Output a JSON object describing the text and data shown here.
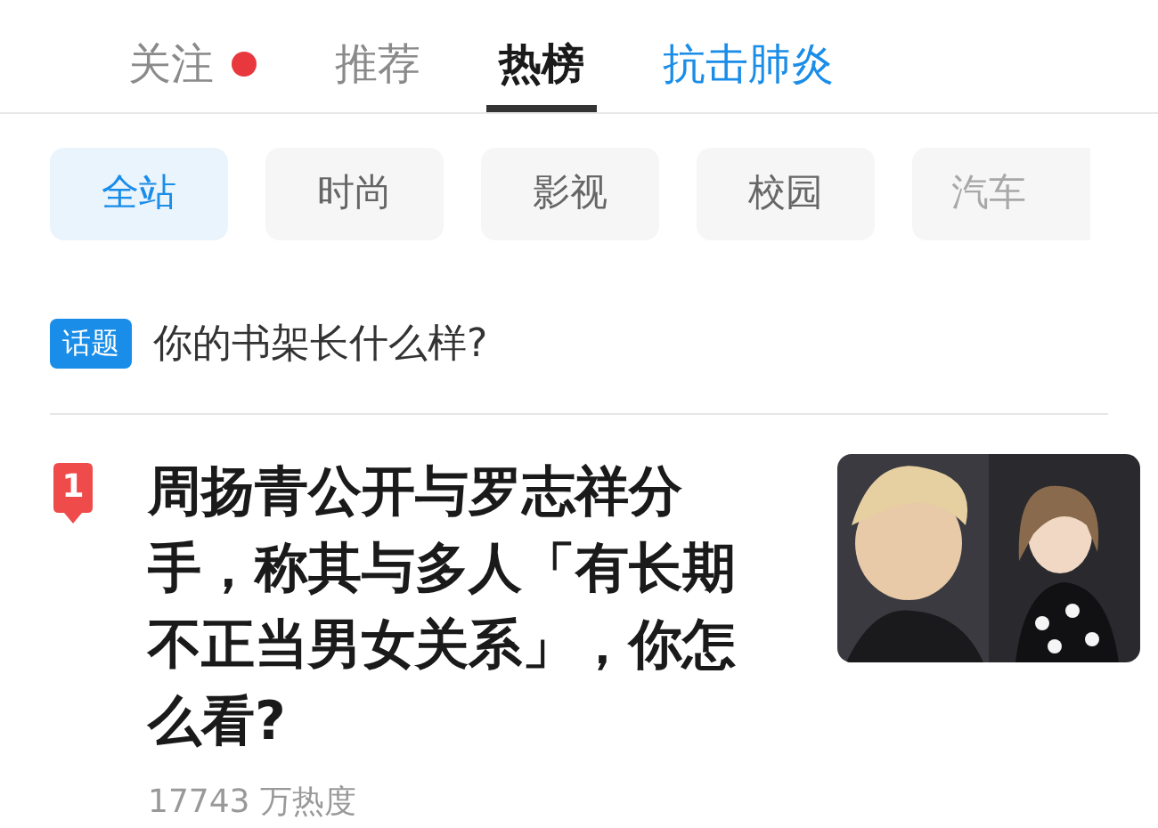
{
  "tabs": [
    {
      "label": "关注",
      "selected": false,
      "kind": "normal",
      "dot": true
    },
    {
      "label": "推荐",
      "selected": false,
      "kind": "normal",
      "dot": false
    },
    {
      "label": "热榜",
      "selected": true,
      "kind": "normal",
      "dot": false
    },
    {
      "label": "抗击肺炎",
      "selected": false,
      "kind": "highlight",
      "dot": false
    }
  ],
  "categories": [
    {
      "label": "全站",
      "selected": true,
      "faded": false
    },
    {
      "label": "时尚",
      "selected": false,
      "faded": false
    },
    {
      "label": "影视",
      "selected": false,
      "faded": false
    },
    {
      "label": "校园",
      "selected": false,
      "faded": false
    },
    {
      "label": "汽车",
      "selected": false,
      "faded": true
    }
  ],
  "topic": {
    "tag": "话题",
    "text": "你的书架长什么样?"
  },
  "items": [
    {
      "rank": "1",
      "title": "周扬青公开与罗志祥分手，称其与多人「有长期不正当男女关系」，你怎么看?",
      "heat": "17743 万热度"
    }
  ]
}
